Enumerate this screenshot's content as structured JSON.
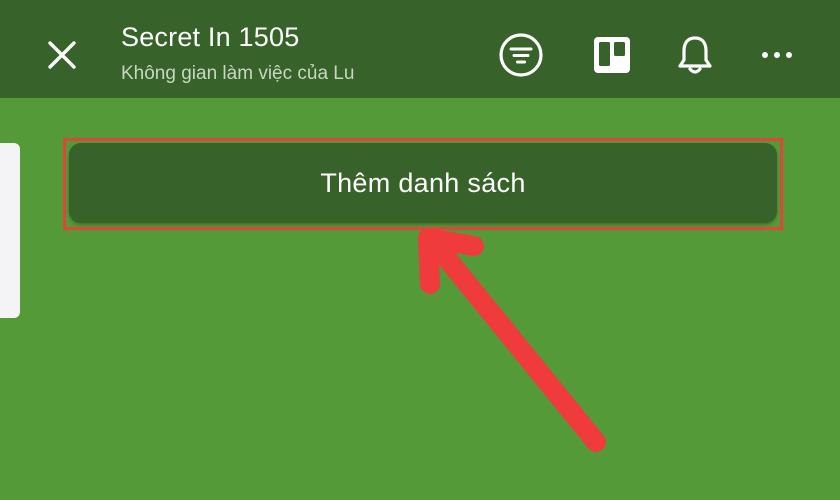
{
  "header": {
    "board_title": "Secret In 1505",
    "workspace": "Không gian làm việc của Lu",
    "icons": [
      "close-icon",
      "filter-icon",
      "board-view-icon",
      "bell-icon",
      "more-icon"
    ]
  },
  "main": {
    "add_list_label": "Thêm danh sách"
  },
  "colors": {
    "header_bg": "#37622a",
    "board_bg": "#559a39",
    "highlight": "#e0443a",
    "arrow": "#ef3b3b"
  }
}
